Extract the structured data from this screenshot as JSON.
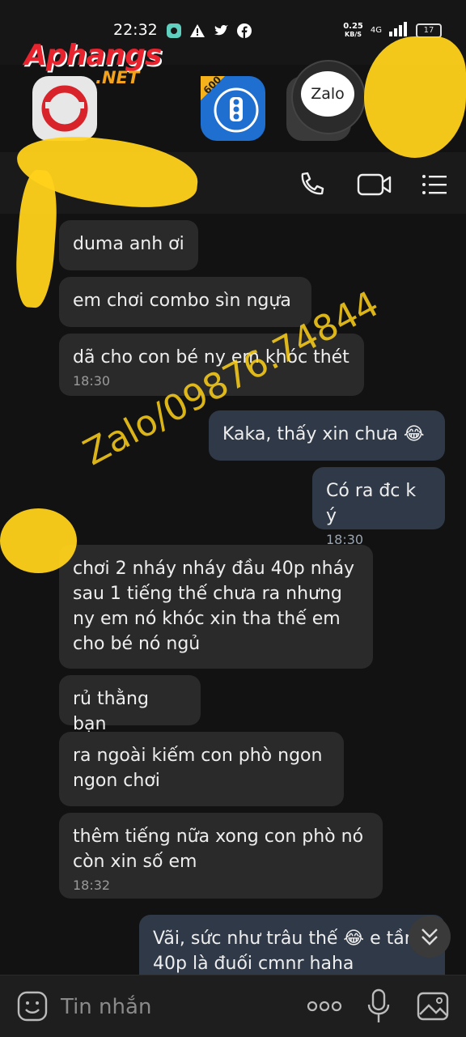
{
  "status_bar": {
    "time": "22:32",
    "net_speed_value": "0.25",
    "net_speed_unit": "KB/S",
    "network": "4G",
    "battery": "17"
  },
  "watermark": {
    "logo_main": "Aphangs",
    "logo_suffix": ".NET",
    "overlay_text": "Zalo/09876.74844"
  },
  "home_apps": {
    "traffic_badge": "600",
    "zalo_label": "Zalo"
  },
  "messages": [
    {
      "side": "left",
      "text": "duma anh ơi",
      "time": ""
    },
    {
      "side": "left",
      "text": "em chơi combo sìn ngựa",
      "time": ""
    },
    {
      "side": "left",
      "text": "dã cho con bé ny em khóc thét",
      "time": "18:30"
    },
    {
      "side": "right",
      "text": "Kaka, thấy xin chưa 😂",
      "time": ""
    },
    {
      "side": "right",
      "text": "Có ra đc k ý",
      "time": "18:30"
    },
    {
      "side": "left",
      "text": "chơi 2 nháy nháy đầu 40p nháy sau 1 tiếng thế chưa ra nhưng ny em nó khóc xin tha thế em cho bé nó ngủ",
      "time": ""
    },
    {
      "side": "left",
      "text": "rủ thằng bạn",
      "time": ""
    },
    {
      "side": "left",
      "text": "ra ngoài kiếm con phò ngon ngon chơi",
      "time": ""
    },
    {
      "side": "left",
      "text": "thêm tiếng nữa xong con phò nó còn xin số em",
      "time": "18:32"
    },
    {
      "side": "right",
      "text": "Vãi, sức như trâu thế 😂 e tầm 40p là đuối cmnr haha",
      "time": ""
    }
  ],
  "composer": {
    "placeholder": "Tin nhắn"
  },
  "colors": {
    "background": "#121212",
    "bubble_in": "#2a2a2a",
    "bubble_out": "#2f3947",
    "watermark_yellow": "#ffd21a"
  }
}
